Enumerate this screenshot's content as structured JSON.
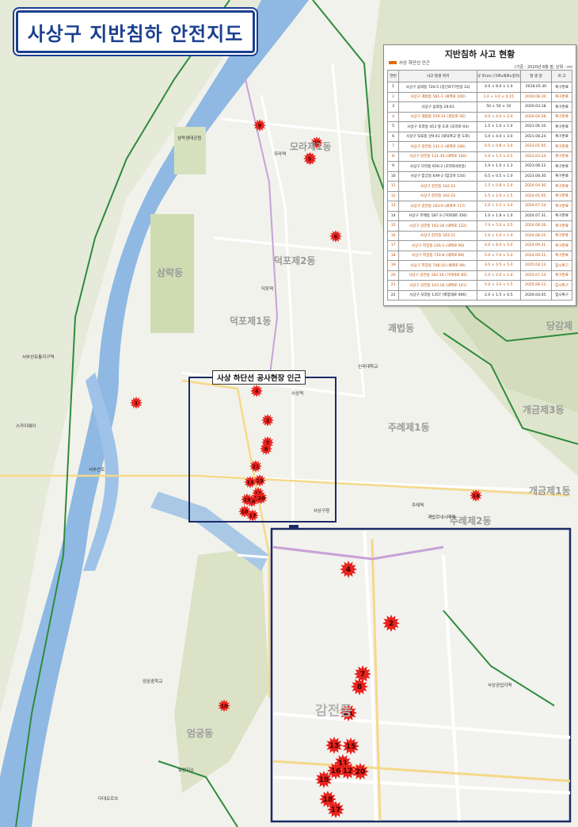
{
  "title": "사상구 지반침하 안전지도",
  "callout_label": "사상 하단선 공사현장 인근",
  "table": {
    "title": "지반침하 사고 현황",
    "legend": "사상 하단선 인근",
    "basis": "(기준 : 2020년 8월 말, 단위 : m)",
    "headers": [
      "연번",
      "사고 발생 위치",
      "규 모(m) (가로x세로x깊이)",
      "발 생 일",
      "비 고"
    ],
    "rows": [
      {
        "no": "1",
        "loc": "사상구 삼락동 726-5 (장인로77번길 33)",
        "size": "4.0 × 8.0 × 1.0",
        "date": "2018.05.30",
        "note": "복구완료",
        "hl": false
      },
      {
        "no": "2",
        "loc": "사상구 괘법동 581-1 (새벽로 200)",
        "size": "1.0 × 3.0 × 0.15",
        "date": "2019.08.10.",
        "note": "복구완료",
        "hl": true
      },
      {
        "no": "3",
        "loc": "사상구 삼락동 29-61",
        "size": "50 × 50 × 10",
        "date": "2020.03.18.",
        "note": "복구완료",
        "hl": false
      },
      {
        "no": "4",
        "loc": "사상구 괘법동 559-14 (광장로 56)",
        "size": "4.0 × 4.0 × 2.0",
        "date": "2020.04.28.",
        "note": "복구완료",
        "hl": true
      },
      {
        "no": "5",
        "loc": "사상구 모라동 453 앞 도로 (모라로 93)",
        "size": "1.5 × 1.0 × 1.0",
        "date": "2021.06.10.",
        "note": "복구완료",
        "hl": false
      },
      {
        "no": "6",
        "loc": "사상구 덕포동 산9-41 (대덕여고 앞 도로)",
        "size": "5.0 × 4.0 × 3.0",
        "date": "2021.08.24.",
        "note": "복구완료",
        "hl": false
      },
      {
        "no": "7",
        "loc": "사상구 감전동 131-1 (새벽로 166)",
        "size": "0.5 × 0.8 × 3.0",
        "date": "2023.01.05.",
        "note": "복구완료",
        "hl": true
      },
      {
        "no": "8",
        "loc": "사상구 감전동 131-30 (새벽로 160)",
        "size": "1.0 × 1.5 × 0.5",
        "date": "2023.03.24.",
        "note": "복구완료",
        "hl": true
      },
      {
        "no": "9",
        "loc": "사상구 모라동 656-2 (모라로4번길)",
        "size": "1.0 × 1.0 × 1.3",
        "date": "2023.08.12.",
        "note": "복구완료",
        "hl": false
      },
      {
        "no": "10",
        "loc": "사상구 엄궁동 649-2 (엄궁로 154)",
        "size": "0.5 × 0.5 × 1.0",
        "date": "2023.08.30.",
        "note": "복구완료",
        "hl": false
      },
      {
        "no": "11",
        "loc": "사상구 감전동 162-22",
        "size": "1.5 × 0.8 × 2.0",
        "date": "2024.04.30.",
        "note": "복구완료",
        "hl": true
      },
      {
        "no": "12",
        "loc": "사상구 감전동 162-22",
        "size": "1.5 × 2.0 × 1.5",
        "date": "2024.05.05.",
        "note": "복구완료",
        "hl": true
      },
      {
        "no": "13",
        "loc": "사상구 감전동 163-6 (새벽로 117)",
        "size": "1.0 × 1.5 × 3.0",
        "date": "2024.07.24.",
        "note": "복구완료",
        "hl": true
      },
      {
        "no": "14",
        "loc": "사상구 주례동 187-3 (가야대로 356)",
        "size": "1.0 × 1.8 × 1.0",
        "date": "2024.07.31.",
        "note": "복구완료",
        "hl": false
      },
      {
        "no": "15",
        "loc": "사상구 감전동 162-26 (새벽로 122)",
        "size": "7.0 × 5.0 × 3.5",
        "date": "2024.08.26.",
        "note": "복구완료",
        "hl": true
      },
      {
        "no": "16",
        "loc": "사상구 감전동 163-11",
        "size": "1.0 × 1.0 × 1.0",
        "date": "2024.08.21.",
        "note": "복구완료",
        "hl": true
      },
      {
        "no": "17",
        "loc": "사상구 학장동 226-1 (새벽로 90)",
        "size": "4.0 × 8.0 × 5.0",
        "date": "2024.09.21.",
        "note": "복구완료",
        "hl": true
      },
      {
        "no": "18",
        "loc": "사상구 학장동 719-8 (새벽로 89)",
        "size": "5.0 × 7.0 × 5.0",
        "date": "2024.09.21.",
        "note": "복구완료",
        "hl": true
      },
      {
        "no": "19",
        "loc": "사상구 학장동 708-10 (새벽로 99)",
        "size": "3.0 × 4.5 × 5.0",
        "date": "2025.04.13.",
        "note": "임시복구",
        "hl": true
      },
      {
        "no": "20",
        "loc": "사상구 감전동 162-10 (가야대로 85)",
        "size": "1.0 × 2.0 × 1.0",
        "date": "2025.07.14.",
        "note": "복구완료",
        "hl": true
      },
      {
        "no": "21",
        "loc": "사상구 감전동 143-16 (새벽로 141)",
        "size": "5.0 × 3.0 × 1.5",
        "date": "2025.08.12.",
        "note": "임시복구",
        "hl": true
      },
      {
        "no": "22",
        "loc": "사상구 모라동 1357 (백양대로 906)",
        "size": "2.0 × 1.5 × 0.5",
        "date": "2026.04.05.",
        "note": "임시복구",
        "hl": false
      }
    ]
  },
  "area_labels": [
    "삼락동",
    "모라제1동",
    "덕포제2동",
    "덕포제1동",
    "괘법동",
    "주례제1동",
    "주례제2동",
    "감전동",
    "엄궁동",
    "개금제3동",
    "개금제1동",
    "당감제"
  ],
  "place_labels": [
    "삼락생태공원",
    "서부산유통지구역",
    "스카이웨이",
    "서부산로",
    "사상역",
    "사상구청",
    "신라대학교",
    "모라역",
    "덕포역",
    "괘법르네시떼역",
    "주례역",
    "엄궁중학교",
    "다대오르쓰",
    "보건지소",
    "사상공업지역"
  ],
  "markers": [
    "1",
    "2",
    "3",
    "4",
    "5",
    "6",
    "7",
    "8",
    "9",
    "10",
    "11",
    "12",
    "13",
    "14",
    "15",
    "16",
    "17",
    "18",
    "19",
    "20",
    "21",
    "22"
  ],
  "inset_markers": [
    "2",
    "4",
    "7",
    "8",
    "11",
    "12",
    "13",
    "15",
    "16",
    "17",
    "18",
    "19",
    "20",
    "21"
  ],
  "colors": {
    "title": "#1b3f8f",
    "marker": "#e8221c",
    "river": "#8fb9e3",
    "highlight_row": "#c05000",
    "boundary": "#2e8b3d",
    "subway": "#c7a2d6"
  }
}
